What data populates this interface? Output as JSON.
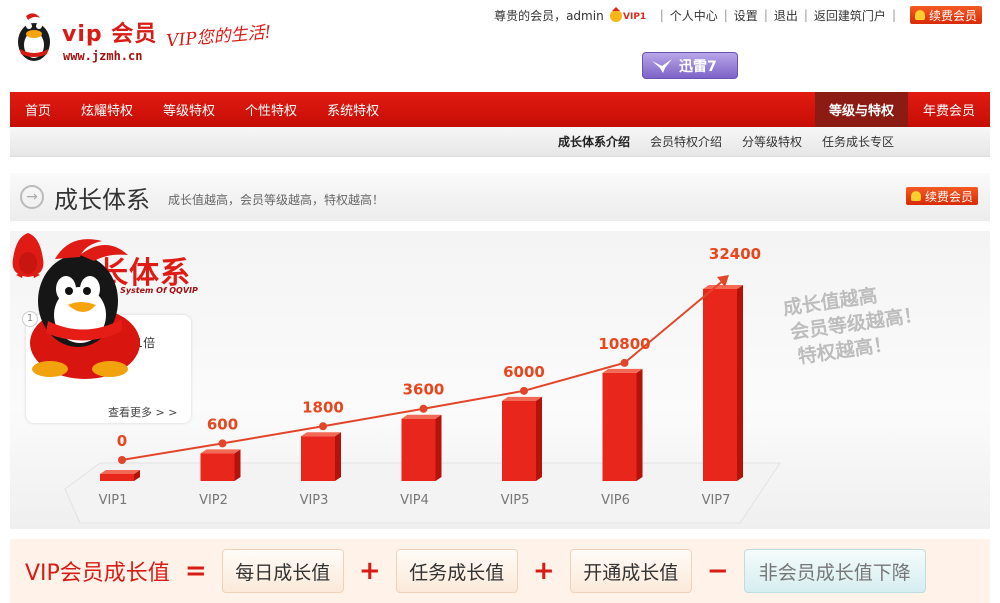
{
  "header": {
    "logo_text": "vip 会员",
    "logo_url": "www.jzmh.cn",
    "slogan": "VIP您的生活!",
    "greeting": "尊贵的会员，admin",
    "vip_badge": "VIP1",
    "links": [
      "个人中心",
      "设置",
      "退出",
      "返回建筑门户"
    ],
    "renew_label": "续费会员",
    "xunlei_label": "迅雷7"
  },
  "mainnav": {
    "items": [
      "首页",
      "炫耀特权",
      "等级特权",
      "个性特权",
      "系统特权"
    ],
    "active": "等级与特权",
    "last": "年费会员"
  },
  "subnav": {
    "items": [
      "成长体系介绍",
      "会员特权介绍",
      "分等级特权",
      "任务成长专区"
    ]
  },
  "section": {
    "title": "成长体系",
    "desc": "成长值越高，会员等级越高，特权越高！",
    "renew_label": "续费会员"
  },
  "growth": {
    "title": "成长体系",
    "subtitle": "The Growth System Of QQVIP",
    "tip_number": "1",
    "tip_text": "VIP等级加速1.1倍",
    "tip_more": "查看更多 > >",
    "slogan": [
      "成长值越高",
      "会员等级越高！",
      "特权越高！"
    ]
  },
  "chart_data": {
    "type": "bar",
    "categories": [
      "VIP1",
      "VIP2",
      "VIP3",
      "VIP4",
      "VIP5",
      "VIP6",
      "VIP7"
    ],
    "values": [
      0,
      600,
      1800,
      3600,
      6000,
      10800,
      32400
    ],
    "value_labels": [
      "0",
      "600",
      "1800",
      "3600",
      "6000",
      "10800",
      "32400"
    ],
    "colors": {
      "bar": "#e8261c",
      "line": "#e2452a",
      "label": "#e8461d"
    }
  },
  "formula": {
    "label": "VIP会员成长值",
    "ops": [
      "=",
      "+",
      "+",
      "−"
    ],
    "boxes": [
      "每日成长值",
      "任务成长值",
      "开通成长值",
      "非会员成长值下降"
    ]
  }
}
